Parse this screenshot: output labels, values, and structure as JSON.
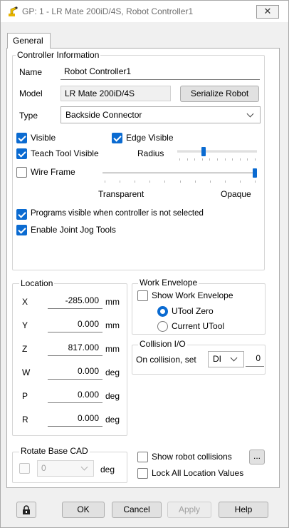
{
  "window": {
    "title": "GP: 1 - LR Mate 200iD/4S, Robot Controller1",
    "close_glyph": "✕",
    "app_icon": "robot-arm-icon"
  },
  "tabs": [
    {
      "label": "General",
      "selected": true
    }
  ],
  "controller_info": {
    "legend": "Controller Information",
    "name_label": "Name",
    "name_value": "Robot Controller1",
    "model_label": "Model",
    "model_value": "LR Mate 200iD/4S",
    "serialize_label": "Serialize Robot",
    "type_label": "Type",
    "type_value": "Backside Connector",
    "visible_label": "Visible",
    "visible_checked": true,
    "edge_visible_label": "Edge Visible",
    "edge_visible_checked": true,
    "teach_tool_label": "Teach Tool Visible",
    "teach_tool_checked": true,
    "radius_label": "Radius",
    "radius_level": 0.32,
    "wire_frame_label": "Wire Frame",
    "wire_frame_checked": false,
    "opacity_level": 1.0,
    "transparent_label": "Transparent",
    "opaque_label": "Opaque",
    "programs_visible_label": "Programs visible when controller is not selected",
    "programs_visible_checked": true,
    "enable_jog_label": "Enable Joint Jog Tools",
    "enable_jog_checked": true
  },
  "location": {
    "legend": "Location",
    "rows": [
      {
        "axis": "X",
        "value": "-285.000",
        "unit": "mm"
      },
      {
        "axis": "Y",
        "value": "0.000",
        "unit": "mm"
      },
      {
        "axis": "Z",
        "value": "817.000",
        "unit": "mm"
      },
      {
        "axis": "W",
        "value": "0.000",
        "unit": "deg"
      },
      {
        "axis": "P",
        "value": "0.000",
        "unit": "deg"
      },
      {
        "axis": "R",
        "value": "0.000",
        "unit": "deg"
      }
    ]
  },
  "work_envelope": {
    "legend": "Work Envelope",
    "show_label": "Show Work Envelope",
    "show_checked": false,
    "utool_zero_label": "UTool Zero",
    "utool_zero_selected": true,
    "current_utool_label": "Current UTool"
  },
  "collision_io": {
    "legend": "Collision I/O",
    "on_collision_label": "On collision, set",
    "io_type": "DI",
    "io_index": "0"
  },
  "rotate_base": {
    "legend": "Rotate Base CAD",
    "checked": false,
    "value": "0",
    "unit": "deg"
  },
  "show_collisions_label": "Show robot collisions",
  "show_collisions_checked": false,
  "ellipsis_label": "...",
  "lock_all_label": "Lock All Location Values",
  "lock_all_checked": false,
  "footer": {
    "lock_icon": "padlock-icon",
    "ok_label": "OK",
    "cancel_label": "Cancel",
    "apply_label": "Apply",
    "help_label": "Help"
  },
  "colors": {
    "accent": "#0b6bd1",
    "panel": "#f0f0f0"
  }
}
